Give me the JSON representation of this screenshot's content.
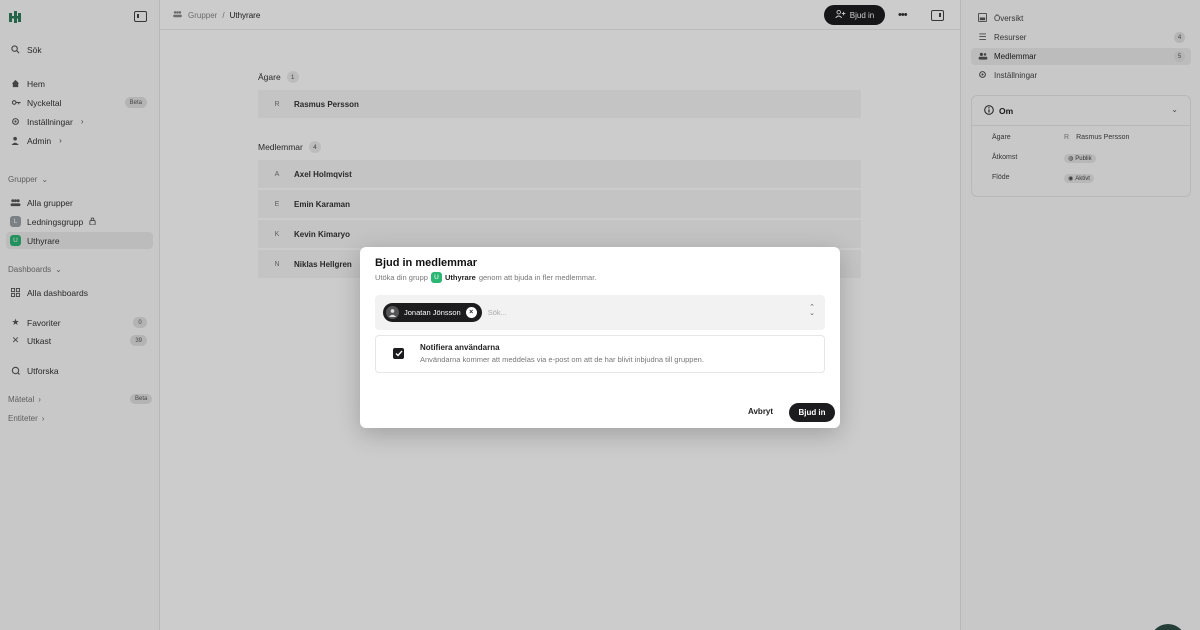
{
  "sidebar": {
    "search": "Sök",
    "nav": [
      {
        "label": "Hem",
        "icon": "home-icon"
      },
      {
        "label": "Nyckeltal",
        "icon": "key-icon",
        "badge": "Beta"
      },
      {
        "label": "Inställningar",
        "icon": "gear-icon"
      },
      {
        "label": "Admin",
        "icon": "admin-icon"
      }
    ],
    "groups_header": "Grupper",
    "groups": [
      {
        "label": "Alla grupper",
        "icon": "users-icon"
      },
      {
        "label": "Ledningsgrupp",
        "initial": "L"
      },
      {
        "label": "Uthyrare",
        "initial": "U"
      }
    ],
    "dashboards_header": "Dashboards",
    "dashboards_item": "Alla dashboards",
    "favorites": {
      "label": "Favoriter",
      "count": "0"
    },
    "drafts": {
      "label": "Utkast",
      "count": "39"
    },
    "explore": "Utforska",
    "metrics": {
      "label": "Mätetal",
      "badge": "Beta"
    },
    "entities": "Entiteter"
  },
  "topbar": {
    "breadcrumb_parent": "Grupper",
    "breadcrumb_sep": "/",
    "breadcrumb_current": "Uthyrare",
    "invite_label": "Bjud in",
    "more_label": "•••"
  },
  "content": {
    "owners_label": "Ägare",
    "owners_count": "1",
    "owners": [
      {
        "initial": "R",
        "name": "Rasmus Persson"
      }
    ],
    "members_label": "Medlemmar",
    "members_count": "4",
    "members": [
      {
        "initial": "A",
        "name": "Axel Holmqvist"
      },
      {
        "initial": "E",
        "name": "Emin Karaman"
      },
      {
        "initial": "K",
        "name": "Kevin Kimaryo"
      },
      {
        "initial": "N",
        "name": "Niklas Hellgren"
      }
    ]
  },
  "rightpanel": {
    "items": [
      {
        "label": "Översikt",
        "icon": "overview-icon"
      },
      {
        "label": "Resurser",
        "icon": "list-icon",
        "count": "4"
      },
      {
        "label": "Medlemmar",
        "icon": "users-icon",
        "count": "5"
      },
      {
        "label": "Inställningar",
        "icon": "gear-icon"
      }
    ],
    "about": {
      "title": "Om",
      "owner_key": "Ägare",
      "owner_initial": "R",
      "owner_value": "Rasmus Persson",
      "access_key": "Åtkomst",
      "access_value": "Publik",
      "flow_key": "Flöde",
      "flow_value": "Aktivt"
    }
  },
  "modal": {
    "title": "Bjud in medlemmar",
    "subtitle_pre": "Utöka din grupp",
    "group_initial": "U",
    "group_name": "Uthyrare",
    "subtitle_post": "genom att bjuda in fler medlemmar.",
    "selected_user": "Jonatan Jönsson",
    "search_placeholder": "Sök...",
    "notify_title": "Notifiera användarna",
    "notify_desc": "Användarna kommer att meddelas via e-post om att de har blivit inbjudna till gruppen.",
    "notify_checked": true,
    "cancel_label": "Avbryt",
    "submit_label": "Bjud in"
  },
  "colors": {
    "accent_dark": "#1c1c1e",
    "group_green": "#2bb673",
    "overlay": "rgba(0,0,0,0.2)"
  }
}
